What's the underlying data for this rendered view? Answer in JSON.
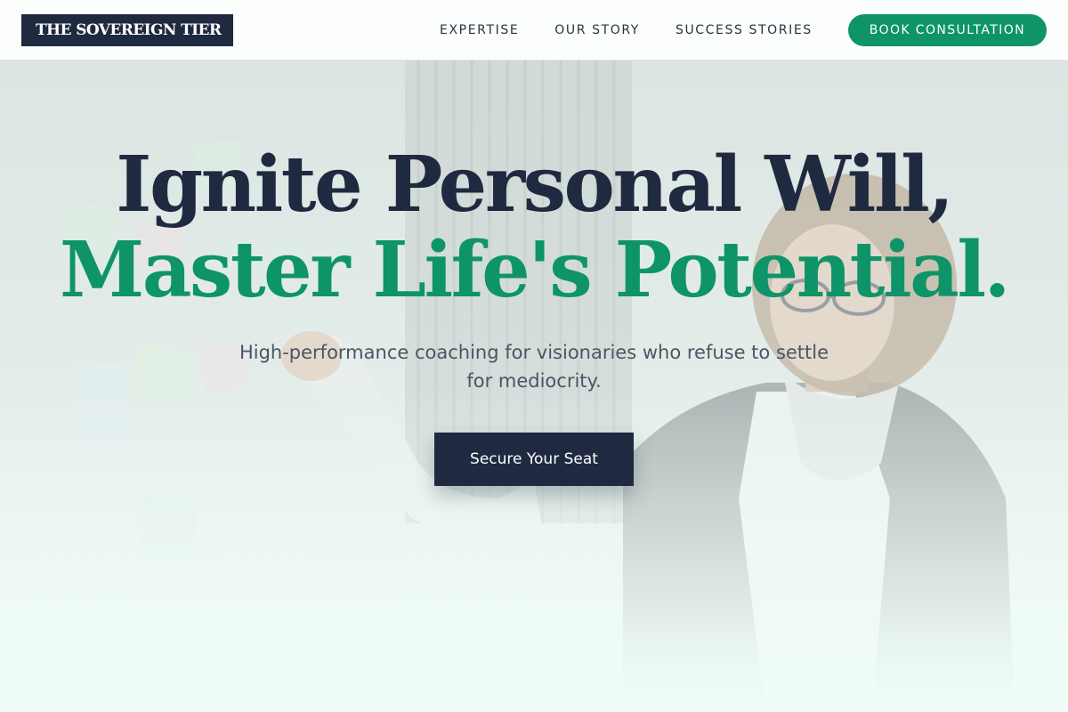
{
  "brand": {
    "logo_text": "THE SOVEREIGN TIER"
  },
  "nav": {
    "links": [
      "EXPERTISE",
      "OUR STORY",
      "SUCCESS STORIES"
    ],
    "cta_label": "BOOK CONSULTATION"
  },
  "hero": {
    "headline_line1": "Ignite Personal Will,",
    "headline_line2": "Master Life's Potential.",
    "subheadline": "High-performance coaching for visionaries who refuse to settle for mediocrity.",
    "button_label": "Secure Your Seat"
  },
  "colors": {
    "navy": "#1f2a40",
    "accent_green": "#0e9468",
    "text_gray": "#4b5563",
    "background": "#eef7f4"
  }
}
